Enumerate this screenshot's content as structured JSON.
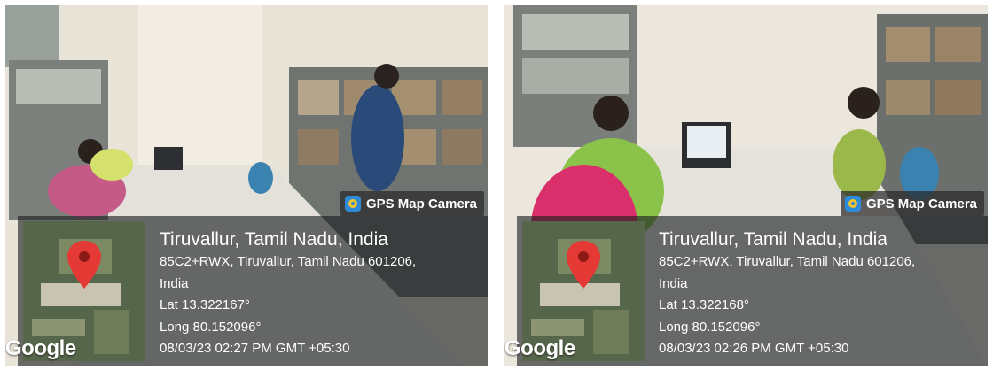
{
  "photos": [
    {
      "badge": "GPS Map Camera",
      "place": "Tiruvallur, Tamil Nadu, India",
      "address_line1": "85C2+RWX, Tiruvallur, Tamil Nadu 601206,",
      "address_line2": "India",
      "lat": "Lat 13.322167°",
      "long": "Long 80.152096°",
      "datetime": "08/03/23 02:27 PM GMT +05:30",
      "map_brand": "Google"
    },
    {
      "badge": "GPS Map Camera",
      "place": "Tiruvallur, Tamil Nadu, India",
      "address_line1": "85C2+RWX, Tiruvallur, Tamil Nadu 601206,",
      "address_line2": "India",
      "lat": "Lat 13.322168°",
      "long": "Long 80.152096°",
      "datetime": "08/03/23 02:26 PM GMT +05:30",
      "map_brand": "Google"
    }
  ],
  "colors": {
    "pin": "#e53935",
    "overlay": "#1c1f21",
    "shelf": "#6b6f6c",
    "wall": "#ece7dc"
  }
}
